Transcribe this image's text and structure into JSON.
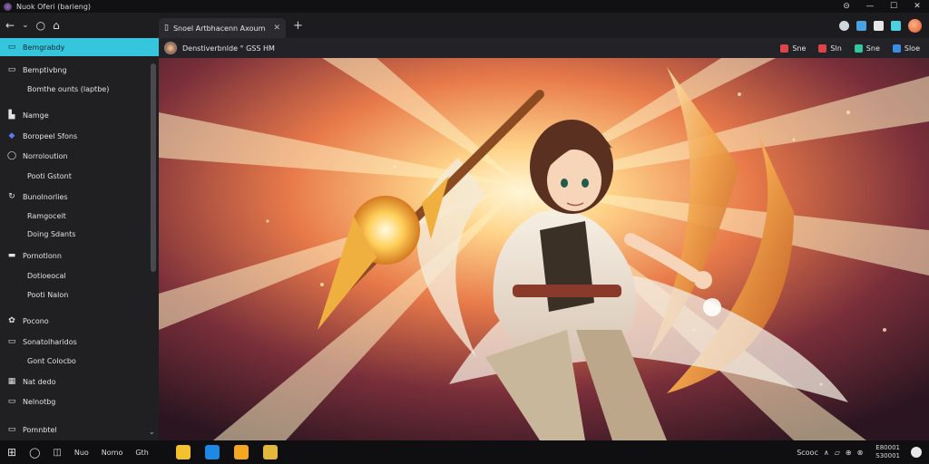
{
  "titlebar": {
    "title": "Nuok Oferi (barieng)",
    "controls": [
      "⊝",
      "—",
      "☐",
      "✕"
    ]
  },
  "nav": {
    "back": "←",
    "dropdown": "⌄",
    "refresh": "○",
    "home": "⌂"
  },
  "tabs": [
    {
      "label": "Snoel Artbhacenn Axoum",
      "close": "✕"
    }
  ],
  "newtab": "+",
  "page": {
    "title": "Denstiverbnlde ° GSS HM",
    "actions": [
      {
        "label": "Sne",
        "color": "#e0444b"
      },
      {
        "label": "Sln",
        "color": "#e0444b"
      },
      {
        "label": "Sne",
        "color": "#2fc6a0"
      },
      {
        "label": "Sloe",
        "color": "#3a8ee6"
      }
    ]
  },
  "sidebar": {
    "items": [
      {
        "label": "Bemgrabdy",
        "icon": "folder-icon",
        "glyph": "▭",
        "active": true,
        "sub": false
      },
      {
        "label": "Bemptivbng",
        "icon": "document-icon",
        "glyph": "▭",
        "active": false,
        "sub": false
      },
      {
        "label": "Bomthe ounts (laptbe)",
        "icon": "",
        "glyph": "",
        "active": false,
        "sub": true
      },
      {
        "label": "Namge",
        "icon": "image-icon",
        "glyph": "▙",
        "active": false,
        "sub": false
      },
      {
        "label": "Boropeel Sfons",
        "icon": "globe-icon",
        "glyph": "◆",
        "active": false,
        "sub": false
      },
      {
        "label": "Norroloution",
        "icon": "circle-icon",
        "glyph": "◯",
        "active": false,
        "sub": false
      },
      {
        "label": "Pooti Gstont",
        "icon": "",
        "glyph": "",
        "active": false,
        "sub": true
      },
      {
        "label": "Bunolnorlies",
        "icon": "refresh-icon",
        "glyph": "↻",
        "active": false,
        "sub": false
      },
      {
        "label": "Ramgoceit",
        "icon": "",
        "glyph": "",
        "active": false,
        "sub": true
      },
      {
        "label": "Doing Sdants",
        "icon": "",
        "glyph": "",
        "active": false,
        "sub": true
      },
      {
        "label": "Pornotlonn",
        "icon": "card-icon",
        "glyph": "▬",
        "active": false,
        "sub": false
      },
      {
        "label": "Dotioeocal",
        "icon": "",
        "glyph": "",
        "active": false,
        "sub": true
      },
      {
        "label": "Pooti Nalon",
        "icon": "",
        "glyph": "",
        "active": false,
        "sub": true
      },
      {
        "label": "Pocono",
        "icon": "gear-icon",
        "glyph": "✿",
        "active": false,
        "sub": false
      },
      {
        "label": "Sonatolharidos",
        "icon": "window-icon",
        "glyph": "▭",
        "active": false,
        "sub": false
      },
      {
        "label": "Gont Colocbo",
        "icon": "",
        "glyph": "",
        "active": false,
        "sub": true
      },
      {
        "label": "Nat dedo",
        "icon": "grid-icon",
        "glyph": "▦",
        "active": false,
        "sub": false
      },
      {
        "label": "Nelnotbg",
        "icon": "note-icon",
        "glyph": "▭",
        "active": false,
        "sub": false
      },
      {
        "label": "Pomnbtel",
        "icon": "bookmark-icon",
        "glyph": "▭",
        "active": false,
        "sub": false
      }
    ]
  },
  "taskbar": {
    "items": [
      "Nuo",
      "Nomo",
      "Gth"
    ],
    "pinned": [
      {
        "icon": "folder-icon",
        "color": "#f2c12e"
      },
      {
        "icon": "edge-icon",
        "color": "#1e88e5"
      },
      {
        "icon": "photos-icon",
        "color": "#f5a623"
      },
      {
        "icon": "shield-icon",
        "color": "#e2b93b"
      }
    ],
    "tray": [
      "Scooc",
      "∧",
      "▱",
      "⊕",
      "⊗"
    ],
    "clock": {
      "time": "E80001",
      "date": "S30001"
    }
  },
  "colors": {
    "accent": "#35c6de"
  }
}
